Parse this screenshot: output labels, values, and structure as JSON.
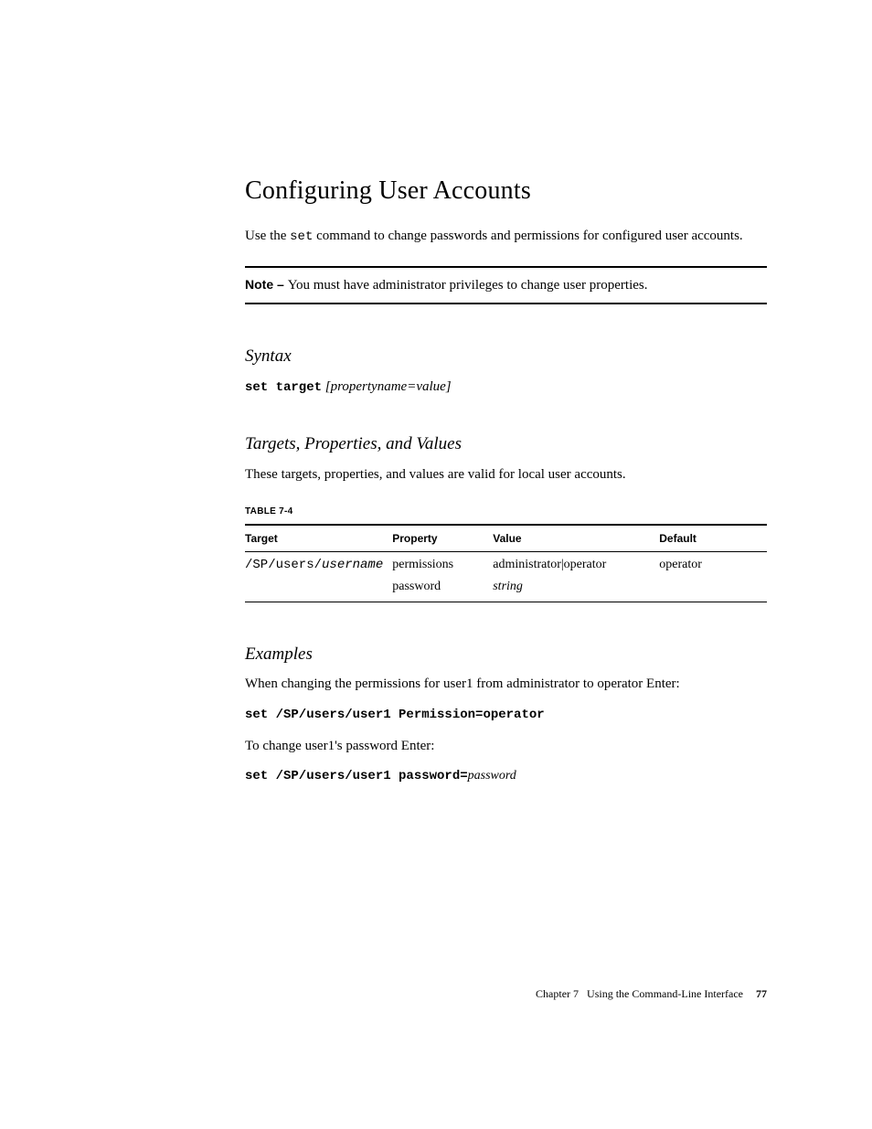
{
  "title": "Configuring User Accounts",
  "intro_a": "Use the ",
  "intro_cmd": "set",
  "intro_b": " command to change passwords and permissions for configured user accounts.",
  "note": {
    "label": "Note – ",
    "text": "You must have administrator privileges to change user properties."
  },
  "syntax": {
    "heading": "Syntax",
    "cmd": "set target",
    "arg": " [propertyname=value]"
  },
  "tpv": {
    "heading": "Targets, Properties, and Values",
    "intro": "These targets, properties, and values are valid for local user accounts.",
    "caption": "TABLE 7-4",
    "headers": {
      "target": "Target",
      "property": "Property",
      "value": "Value",
      "default": "Default"
    },
    "rows": [
      {
        "target_a": "/SP/users/",
        "target_b": "username",
        "property": "permissions",
        "value": "administrator|operator",
        "default": "operator"
      },
      {
        "target_a": "",
        "target_b": "",
        "property": "password",
        "value": "string",
        "default": ""
      }
    ]
  },
  "examples": {
    "heading": "Examples",
    "p1": "When changing the permissions for user1 from administrator to operator Enter:",
    "cmd1": "set /SP/users/user1 Permission=operator",
    "p2": "To change user1's password Enter:",
    "cmd2_a": "set /SP/users/user1 password=",
    "cmd2_b": "password"
  },
  "footer": {
    "chapter": "Chapter 7",
    "title": "Using the Command-Line Interface",
    "page": "77"
  }
}
